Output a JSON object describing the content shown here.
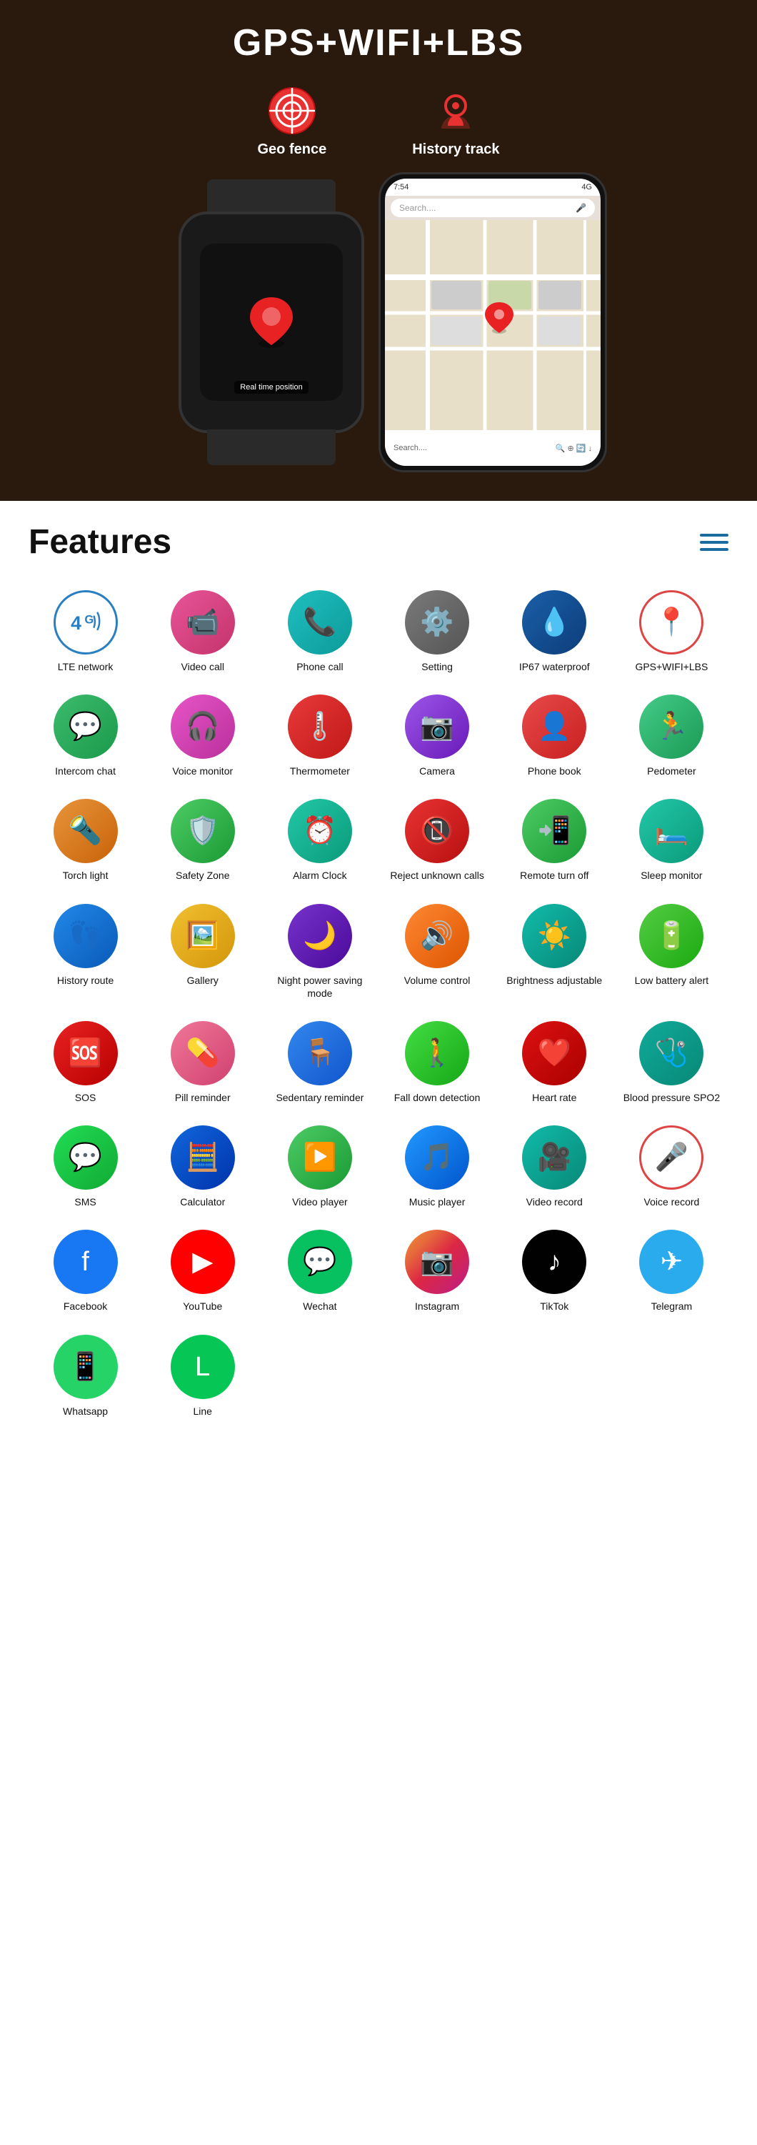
{
  "hero": {
    "title": "GPS+WIFI+LBS",
    "geo_fence_label": "Geo fence",
    "history_track_label": "History track",
    "real_time_position": "Real time position",
    "watch_alt": "Smart watch",
    "phone_alt": "Phone with map",
    "status_time": "7:54",
    "status_signal": "4G",
    "search_placeholder": "Search....",
    "search_placeholder2": "Search...."
  },
  "features": {
    "title": "Features",
    "menu_icon": "hamburger",
    "items": [
      {
        "label": "LTE network",
        "icon": "4g",
        "color_class": "ic-blue-outline"
      },
      {
        "label": "Video call",
        "icon": "📹",
        "color_class": "ic-pink"
      },
      {
        "label": "Phone call",
        "icon": "📞",
        "color_class": "ic-teal"
      },
      {
        "label": "Setting",
        "icon": "⚙️",
        "color_class": "ic-gray"
      },
      {
        "label": "IP67 waterproof",
        "icon": "💧",
        "color_class": "ic-darkblue"
      },
      {
        "label": "GPS+WIFI+LBS",
        "icon": "📍",
        "color_class": "ic-red-outline"
      },
      {
        "label": "Intercom chat",
        "icon": "💬",
        "color_class": "ic-green-chat"
      },
      {
        "label": "Voice monitor",
        "icon": "🎧",
        "color_class": "ic-pink2"
      },
      {
        "label": "Thermometer",
        "icon": "🌡️",
        "color_class": "ic-red"
      },
      {
        "label": "Camera",
        "icon": "📷",
        "color_class": "ic-purple"
      },
      {
        "label": "Phone book",
        "icon": "👤",
        "color_class": "ic-red2"
      },
      {
        "label": "Pedometer",
        "icon": "🏃",
        "color_class": "ic-green2"
      },
      {
        "label": "Torch light",
        "icon": "🔦",
        "color_class": "ic-orange"
      },
      {
        "label": "Safety Zone",
        "icon": "🛡️",
        "color_class": "ic-green3"
      },
      {
        "label": "Alarm Clock",
        "icon": "⏰",
        "color_class": "ic-teal2"
      },
      {
        "label": "Reject unknown calls",
        "icon": "📵",
        "color_class": "ic-red3"
      },
      {
        "label": "Remote turn off",
        "icon": "📲",
        "color_class": "ic-green3"
      },
      {
        "label": "Sleep monitor",
        "icon": "🛏️",
        "color_class": "ic-teal2"
      },
      {
        "label": "History route",
        "icon": "👣",
        "color_class": "ic-blue2"
      },
      {
        "label": "Gallery",
        "icon": "🖼️",
        "color_class": "ic-yellow"
      },
      {
        "label": "Night power saving mode",
        "icon": "🌙",
        "color_class": "ic-purple2"
      },
      {
        "label": "Volume control",
        "icon": "🔊",
        "color_class": "ic-orange2"
      },
      {
        "label": "Brightness adjustable",
        "icon": "☀️",
        "color_class": "ic-teal3"
      },
      {
        "label": "Low battery alert",
        "icon": "🔋",
        "color_class": "ic-green4"
      },
      {
        "label": "SOS",
        "icon": "🆘",
        "color_class": "ic-red4"
      },
      {
        "label": "Pill reminder",
        "icon": "💊",
        "color_class": "ic-pink3"
      },
      {
        "label": "Sedentary reminder",
        "icon": "🪑",
        "color_class": "ic-blue3"
      },
      {
        "label": "Fall down detection",
        "icon": "🚶",
        "color_class": "ic-green5"
      },
      {
        "label": "Heart rate",
        "icon": "❤️",
        "color_class": "ic-red5"
      },
      {
        "label": "Blood pressure SPO2",
        "icon": "🩺",
        "color_class": "ic-teal4"
      },
      {
        "label": "SMS",
        "icon": "💬",
        "color_class": "ic-green6"
      },
      {
        "label": "Calculator",
        "icon": "🧮",
        "color_class": "ic-blue4"
      },
      {
        "label": "Video player",
        "icon": "▶️",
        "color_class": "ic-green3"
      },
      {
        "label": "Music player",
        "icon": "🎵",
        "color_class": "ic-blue5"
      },
      {
        "label": "Video record",
        "icon": "🎥",
        "color_class": "ic-teal3"
      },
      {
        "label": "Voice record",
        "icon": "🎤",
        "color_class": "ic-red-outline"
      },
      {
        "label": "Facebook",
        "icon": "f",
        "color_class": "ic-fb"
      },
      {
        "label": "YouTube",
        "icon": "▶",
        "color_class": "ic-yt"
      },
      {
        "label": "Wechat",
        "icon": "💬",
        "color_class": "ic-wechat"
      },
      {
        "label": "Instagram",
        "icon": "📷",
        "color_class": "ic-insta"
      },
      {
        "label": "TikTok",
        "icon": "♪",
        "color_class": "ic-tiktok"
      },
      {
        "label": "Telegram",
        "icon": "✈",
        "color_class": "ic-telegram"
      },
      {
        "label": "Whatsapp",
        "icon": "📱",
        "color_class": "ic-whatsapp"
      },
      {
        "label": "Line",
        "icon": "L",
        "color_class": "ic-line"
      }
    ]
  }
}
